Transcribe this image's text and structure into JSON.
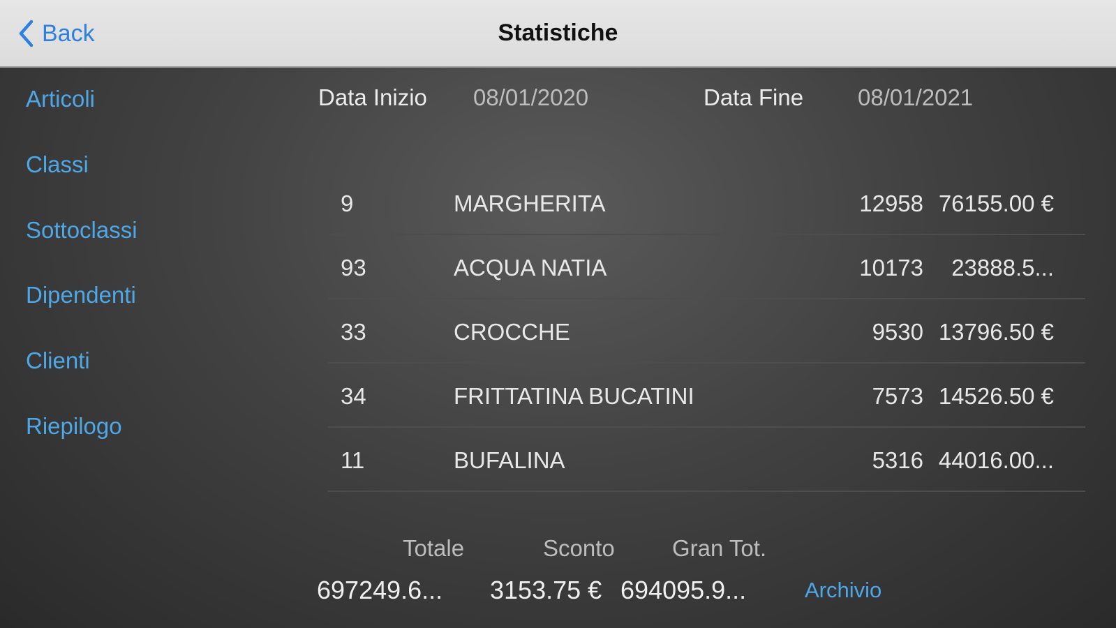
{
  "navbar": {
    "back_label": "Back",
    "title": "Statistiche"
  },
  "sidebar": {
    "items": [
      {
        "label": "Articoli"
      },
      {
        "label": "Classi"
      },
      {
        "label": "Sottoclassi"
      },
      {
        "label": "Dipendenti"
      },
      {
        "label": "Clienti"
      },
      {
        "label": "Riepilogo"
      }
    ]
  },
  "filters": {
    "start_label": "Data Inizio",
    "start_value": "08/01/2020",
    "end_label": "Data Fine",
    "end_value": "08/01/2021"
  },
  "table": {
    "rows": [
      {
        "code": "9",
        "name": "MARGHERITA",
        "qty": "12958",
        "amount": "76155.00 €"
      },
      {
        "code": "93",
        "name": "ACQUA NATIA",
        "qty": "10173",
        "amount": "23888.5..."
      },
      {
        "code": "33",
        "name": "CROCCHE",
        "qty": "9530",
        "amount": "13796.50 €"
      },
      {
        "code": "34",
        "name": "FRITTATINA BUCATINI",
        "qty": "7573",
        "amount": "14526.50 €"
      },
      {
        "code": "11",
        "name": "BUFALINA",
        "qty": "5316",
        "amount": "44016.00..."
      }
    ]
  },
  "totals": {
    "totale_label": "Totale",
    "sconto_label": "Sconto",
    "grantot_label": "Gran Tot.",
    "totale_value": "697249.6...",
    "sconto_value": "3153.75 €",
    "grantot_value": "694095.9...",
    "archivio_label": "Archivio"
  },
  "colors": {
    "accent": "#4ea8e8",
    "nav_accent": "#2f7fe0",
    "navbar_bg": "#e0e0e0"
  },
  "icons": {
    "back": "chevron-left-icon"
  }
}
